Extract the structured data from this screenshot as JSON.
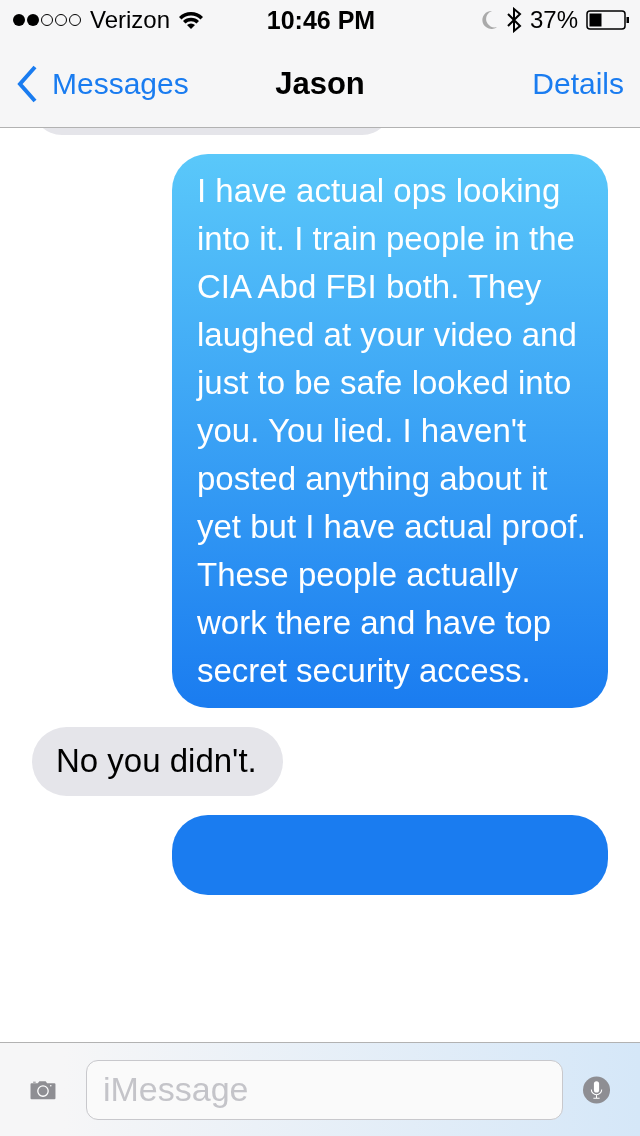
{
  "status_bar": {
    "carrier": "Verizon",
    "time": "10:46 PM",
    "battery": "37%"
  },
  "nav": {
    "back": "Messages",
    "title": "Jason",
    "action": "Details"
  },
  "messages": [
    {
      "kind": "received"
    },
    {
      "kind": "sent",
      "text": "I have actual ops looking into it. I train people in the CIA Abd FBI both. They laughed at your video and just to be safe looked into you. You lied. I haven't posted anything about it yet but I have actual proof. These people actually work there and have top secret security access."
    },
    {
      "kind": "received",
      "text": "No you didn't."
    },
    {
      "kind": "sent"
    }
  ],
  "composer": {
    "placeholder": "iMessage"
  }
}
